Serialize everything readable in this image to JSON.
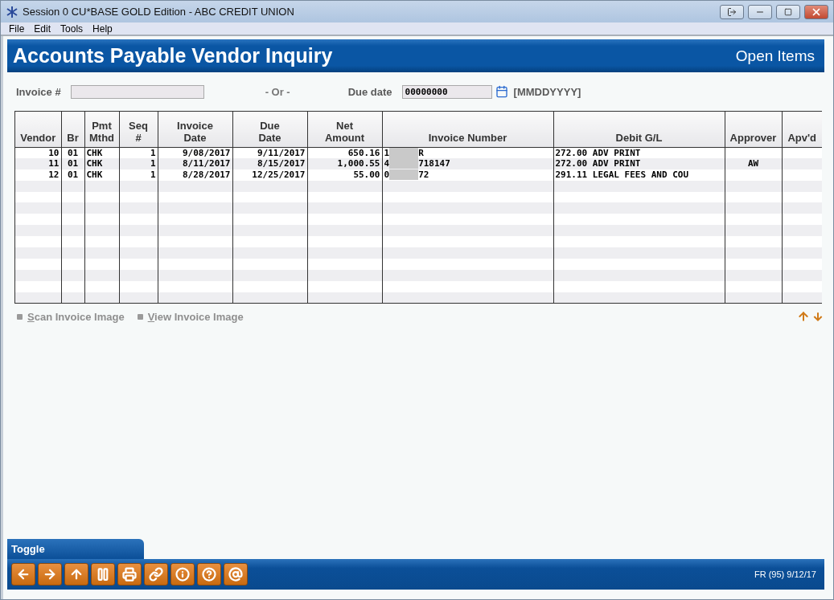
{
  "window": {
    "title": "Session 0 CU*BASE GOLD Edition - ABC CREDIT UNION"
  },
  "menu": [
    "File",
    "Edit",
    "Tools",
    "Help"
  ],
  "header": {
    "title": "Accounts Payable Vendor Inquiry",
    "subtitle": "Open Items"
  },
  "filters": {
    "invoice_label": "Invoice #",
    "or_label": "- Or -",
    "due_label": "Due date",
    "due_value": "00000000",
    "due_format": "[MMDDYYYY]"
  },
  "table": {
    "columns": [
      "Vendor",
      "Br",
      "Pmt Mthd",
      "Seq #",
      "Invoice Date",
      "Due Date",
      "Net Amount",
      "Invoice Number",
      "Debit G/L",
      "Approver",
      "Apv'd"
    ],
    "rows": [
      {
        "vendor": "10",
        "br": "01",
        "pmt": "CHK",
        "seq": "1",
        "invoice_date": "9/08/2017",
        "due_date": "9/11/2017",
        "net": "650.16",
        "invoice_prefix": "1",
        "invoice_suffix": "R",
        "debit": "272.00 ADV PRINT",
        "approver": ""
      },
      {
        "vendor": "11",
        "br": "01",
        "pmt": "CHK",
        "seq": "1",
        "invoice_date": "8/11/2017",
        "due_date": "8/15/2017",
        "net": "1,000.55",
        "invoice_prefix": "4",
        "invoice_suffix": "718147",
        "debit": "272.00 ADV PRINT",
        "approver": "AW"
      },
      {
        "vendor": "12",
        "br": "01",
        "pmt": "CHK",
        "seq": "1",
        "invoice_date": "8/28/2017",
        "due_date": "12/25/2017",
        "net": "55.00",
        "invoice_prefix": "0",
        "invoice_suffix": "72",
        "debit": "291.11 LEGAL FEES AND COU",
        "approver": ""
      }
    ]
  },
  "actions": [
    {
      "key": "S",
      "rest": "can Invoice Image",
      "disabled": true
    },
    {
      "key": "V",
      "rest": "iew Invoice Image",
      "disabled": true
    }
  ],
  "toggle_tab": "Toggle",
  "status": "FR (95) 9/12/17"
}
